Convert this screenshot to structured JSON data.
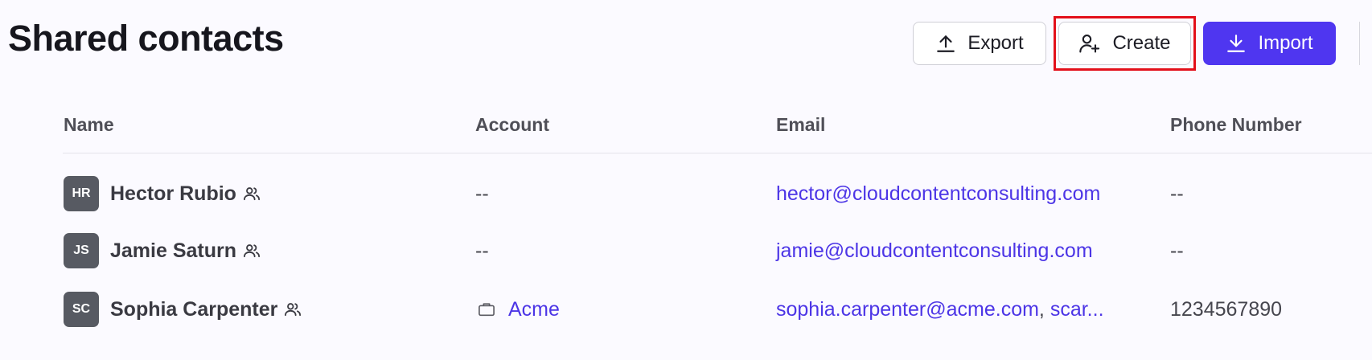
{
  "header": {
    "title": "Shared contacts",
    "buttons": {
      "export_label": "Export",
      "create_label": "Create",
      "import_label": "Import"
    }
  },
  "colors": {
    "primary": "#4f36f0",
    "link": "#4c35e6",
    "highlight": "#e3101a",
    "avatar": "#575a62"
  },
  "table": {
    "columns": [
      "Name",
      "Account",
      "Email",
      "Phone Number"
    ],
    "rows": [
      {
        "initials": "HR",
        "name": "Hector Rubio",
        "account": "--",
        "email": "hector@cloudcontentconsulting.com",
        "phone": "--"
      },
      {
        "initials": "JS",
        "name": "Jamie Saturn",
        "account": "--",
        "email": "jamie@cloudcontentconsulting.com",
        "phone": "--"
      },
      {
        "initials": "SC",
        "name": "Sophia Carpenter",
        "account": "Acme",
        "email": "sophia.carpenter@acme.com",
        "email_extra": "scar...",
        "phone": "1234567890"
      }
    ]
  }
}
